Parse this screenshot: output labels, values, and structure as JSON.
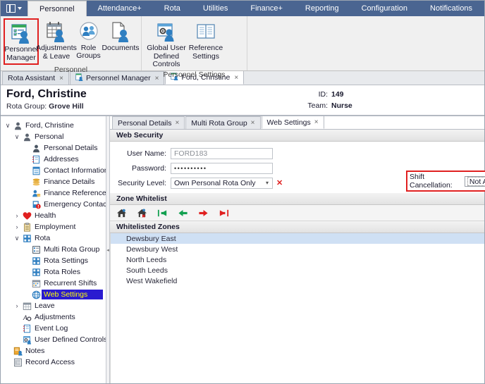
{
  "ribbon": {
    "app_button_icon": "book-menu-icon",
    "tabs": [
      {
        "label": "Personnel",
        "active": true
      },
      {
        "label": "Attendance+",
        "active": false
      },
      {
        "label": "Rota",
        "active": false
      },
      {
        "label": "Utilities",
        "active": false
      },
      {
        "label": "Finance+",
        "active": false
      },
      {
        "label": "Reporting",
        "active": false
      },
      {
        "label": "Configuration",
        "active": false
      },
      {
        "label": "Notifications",
        "active": false
      }
    ],
    "groups": [
      {
        "label": "Personnel",
        "items": [
          {
            "label": "Personnel\nManager",
            "line1": "Personnel",
            "line2": "Manager",
            "icon": "personnel-manager-icon",
            "selected": true
          },
          {
            "label": "Adjustments & Leave",
            "line1": "Adjustments",
            "line2": "& Leave",
            "icon": "adjustments-leave-icon",
            "selected": false
          },
          {
            "label": "Role Groups",
            "line1": "Role Groups",
            "line2": "",
            "icon": "role-groups-icon",
            "selected": false
          },
          {
            "label": "Documents",
            "line1": "Documents",
            "line2": "",
            "icon": "documents-icon",
            "selected": false
          }
        ]
      },
      {
        "label": "Personnel Settings",
        "items": [
          {
            "label": "Global User Defined Controls",
            "line1": "Global User",
            "line2": "Defined Controls",
            "icon": "global-user-defined-controls-icon",
            "selected": false
          },
          {
            "label": "Reference Settings",
            "line1": "Reference",
            "line2": "Settings",
            "icon": "reference-settings-icon",
            "selected": false
          }
        ]
      }
    ]
  },
  "document_tabs": [
    {
      "label": "Rota Assistant",
      "active": false,
      "has_icon": false,
      "close": "×"
    },
    {
      "label": "Personnel Manager",
      "active": false,
      "has_icon": true,
      "close": "×"
    },
    {
      "label": "Ford, Christine",
      "active": true,
      "has_icon": true,
      "close": "×"
    }
  ],
  "record_header": {
    "name": "Ford, Christine",
    "rota_group_label": "Rota Group:",
    "rota_group_value": "Grove Hill",
    "id_label": "ID:",
    "id_value": "149",
    "team_label": "Team:",
    "team_value": "Nurse"
  },
  "tree": [
    {
      "label": "Ford, Christine",
      "indent": 0,
      "expander": "∨",
      "icon": "person-icon",
      "selected": false
    },
    {
      "label": "Personal",
      "indent": 1,
      "expander": "∨",
      "icon": "person-icon",
      "selected": false
    },
    {
      "label": "Personal Details",
      "indent": 2,
      "expander": "",
      "icon": "person-details-icon",
      "selected": false
    },
    {
      "label": "Addresses",
      "indent": 2,
      "expander": "",
      "icon": "addresses-icon",
      "selected": false
    },
    {
      "label": "Contact Information",
      "indent": 2,
      "expander": "",
      "icon": "contact-information-icon",
      "selected": false
    },
    {
      "label": "Finance Details",
      "indent": 2,
      "expander": "",
      "icon": "finance-details-icon",
      "selected": false
    },
    {
      "label": "Finance References",
      "indent": 2,
      "expander": "",
      "icon": "finance-references-icon",
      "selected": false
    },
    {
      "label": "Emergency Contacts",
      "indent": 2,
      "expander": "",
      "icon": "emergency-contacts-icon",
      "selected": false
    },
    {
      "label": "Health",
      "indent": 1,
      "expander": "›",
      "icon": "heart-icon",
      "selected": false
    },
    {
      "label": "Employment",
      "indent": 1,
      "expander": "›",
      "icon": "clipboard-icon",
      "selected": false
    },
    {
      "label": "Rota",
      "indent": 1,
      "expander": "∨",
      "icon": "rota-icon",
      "selected": false
    },
    {
      "label": "Multi Rota Group",
      "indent": 2,
      "expander": "",
      "icon": "multi-rota-group-icon",
      "selected": false
    },
    {
      "label": "Rota Settings",
      "indent": 2,
      "expander": "",
      "icon": "rota-settings-icon",
      "selected": false
    },
    {
      "label": "Rota Roles",
      "indent": 2,
      "expander": "",
      "icon": "rota-roles-icon",
      "selected": false
    },
    {
      "label": "Recurrent Shifts",
      "indent": 2,
      "expander": "",
      "icon": "recurrent-shifts-icon",
      "selected": false
    },
    {
      "label": "Web Settings",
      "indent": 2,
      "expander": "",
      "icon": "web-settings-icon",
      "selected": true
    },
    {
      "label": "Leave",
      "indent": 1,
      "expander": "›",
      "icon": "leave-calendar-icon",
      "selected": false
    },
    {
      "label": "Adjustments",
      "indent": 1,
      "expander": "",
      "icon": "adjustments-icon",
      "selected": false
    },
    {
      "label": "Event Log",
      "indent": 1,
      "expander": "",
      "icon": "event-log-icon",
      "selected": false
    },
    {
      "label": "User Defined Controls",
      "indent": 1,
      "expander": "",
      "icon": "user-defined-controls-icon",
      "selected": false
    },
    {
      "label": "Notes",
      "indent": 0,
      "expander": "",
      "icon": "notes-icon",
      "selected": false
    },
    {
      "label": "Record Access",
      "indent": 0,
      "expander": "",
      "icon": "record-access-icon",
      "selected": false
    }
  ],
  "inner_tabs": [
    {
      "label": "Personal Details",
      "active": false,
      "close": "×"
    },
    {
      "label": "Multi Rota Group",
      "active": false,
      "close": "×"
    },
    {
      "label": "Web Settings",
      "active": true,
      "close": "×"
    }
  ],
  "web_security": {
    "section_title": "Web Security",
    "user_name_label": "User Name:",
    "user_name_value": "FORD183",
    "password_label": "Password:",
    "password_value": "••••••••••",
    "security_level_label": "Security Level:",
    "security_level_value": "Own Personal Rota Only",
    "security_level_dropdown": "▾",
    "security_level_clear": "✕",
    "shift_cancellation_label": "Shift Cancellation:",
    "shift_cancellation_value": "Not Allowed",
    "shift_cancellation_dropdown": "▾"
  },
  "zone_whitelist": {
    "section_title": "Zone Whitelist",
    "toolbar": [
      {
        "name": "add-home-zone-icon",
        "title": "Add Home Zone"
      },
      {
        "name": "remove-home-zone-icon",
        "title": "Remove Home Zone"
      },
      {
        "name": "move-all-left-icon",
        "title": "Move All Left"
      },
      {
        "name": "move-left-icon",
        "title": "Move Left"
      },
      {
        "name": "move-right-icon",
        "title": "Move Right"
      },
      {
        "name": "move-all-right-icon",
        "title": "Move All Right"
      }
    ],
    "grid_header": "Whitelisted Zones",
    "rows": [
      {
        "label": "Dewsbury East",
        "selected": true
      },
      {
        "label": "Dewsbury West",
        "selected": false
      },
      {
        "label": "North Leeds",
        "selected": false
      },
      {
        "label": "South Leeds",
        "selected": false
      },
      {
        "label": "West Wakefield",
        "selected": false
      }
    ]
  },
  "colors": {
    "ribbon_blue": "#4a6591",
    "highlight_red": "#e02020",
    "tree_selection_bg": "#2a1bd0",
    "tree_selection_fg": "#ffff00",
    "grid_selection_bg": "#cfe0f4",
    "icon_blue": "#2f7fc1",
    "green_arrow": "#12a050",
    "red_arrow": "#e02020"
  }
}
